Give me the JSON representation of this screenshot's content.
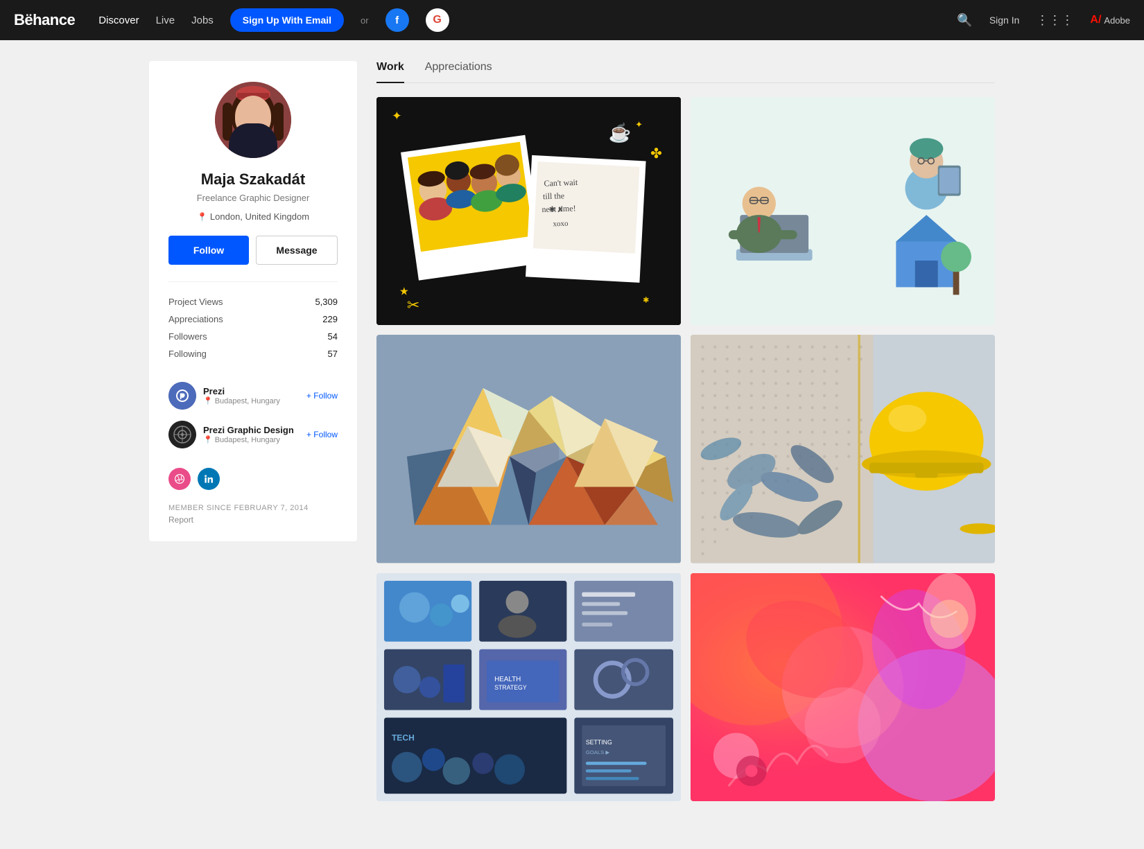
{
  "navbar": {
    "brand": "Bëhance",
    "nav_items": [
      {
        "label": "Discover",
        "active": true
      },
      {
        "label": "Live",
        "active": false
      },
      {
        "label": "Jobs",
        "active": false
      }
    ],
    "signup_label": "Sign Up With Email",
    "or_label": "or",
    "signin_label": "Sign In",
    "adobe_label": "Adobe"
  },
  "profile": {
    "name": "Maja Szakadát",
    "title": "Freelance Graphic Designer",
    "location": "London, United Kingdom",
    "follow_label": "Follow",
    "message_label": "Message",
    "stats": [
      {
        "label": "Project Views",
        "value": "5,309"
      },
      {
        "label": "Appreciations",
        "value": "229"
      },
      {
        "label": "Followers",
        "value": "54"
      },
      {
        "label": "Following",
        "value": "57"
      }
    ],
    "following_orgs": [
      {
        "name": "Prezi",
        "location": "Budapest, Hungary",
        "follow_label": "+ Follow"
      },
      {
        "name": "Prezi Graphic Design",
        "location": "Budapest, Hungary",
        "follow_label": "+ Follow"
      }
    ],
    "member_since": "MEMBER SINCE FEBRUARY 7, 2014",
    "report_label": "Report"
  },
  "tabs": [
    {
      "label": "Work",
      "active": true
    },
    {
      "label": "Appreciations",
      "active": false
    }
  ],
  "portfolio": {
    "items": [
      {
        "id": 1,
        "type": "polaroid",
        "alt": "Polaroid illustration with group photo"
      },
      {
        "id": 2,
        "type": "remote",
        "alt": "Remote work team illustration"
      },
      {
        "id": 3,
        "type": "geo",
        "alt": "Geometric triangle paper art"
      },
      {
        "id": 4,
        "type": "helmet",
        "alt": "Yellow safety helmet on pegboard"
      },
      {
        "id": 5,
        "type": "presentation",
        "alt": "Presentation slides design"
      },
      {
        "id": 6,
        "type": "abstract",
        "alt": "Abstract colorful illustration"
      }
    ]
  }
}
